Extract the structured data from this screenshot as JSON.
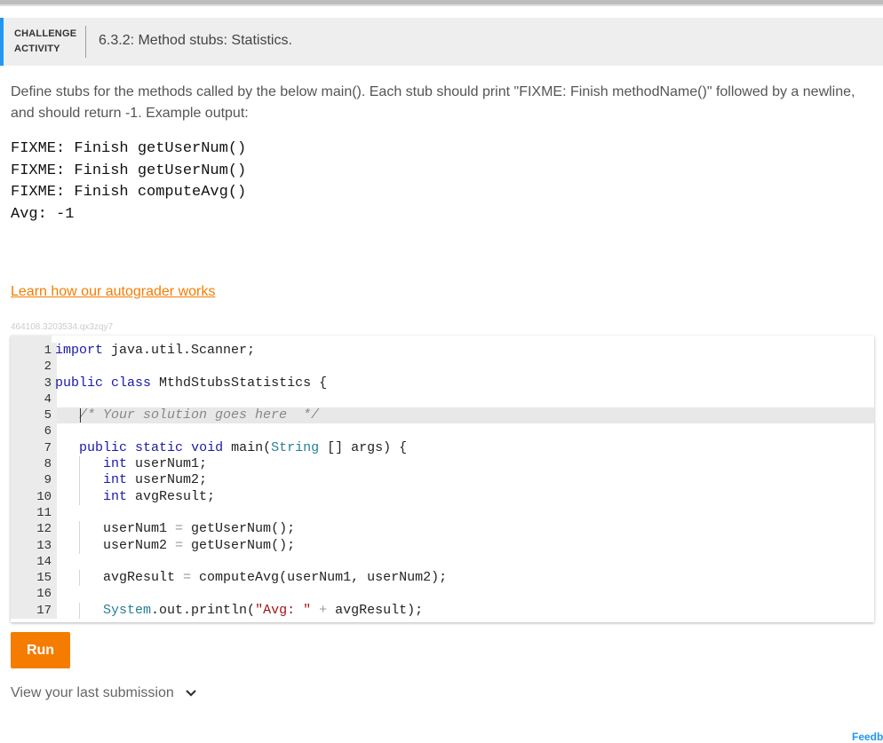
{
  "header": {
    "badge_line1": "CHALLENGE",
    "badge_line2": "ACTIVITY",
    "title": "6.3.2: Method stubs: Statistics."
  },
  "description": "Define stubs for the methods called by the below main(). Each stub should print \"FIXME: Finish methodName()\" followed by a newline, and should return -1. Example output:",
  "example_output": [
    "FIXME: Finish getUserNum()",
    "FIXME: Finish getUserNum()",
    "FIXME: Finish computeAvg()",
    "Avg: -1"
  ],
  "learn_link": "Learn how our autograder works",
  "activity_id": "464108.3203534.qx3zqy7",
  "editor": {
    "line_numbers": [
      "1",
      "2",
      "3",
      "4",
      "5",
      "6",
      "7",
      "8",
      "9",
      "10",
      "11",
      "12",
      "13",
      "14",
      "15",
      "16",
      "17"
    ],
    "active_line": 5
  },
  "run_label": "Run",
  "view_last_label": "View your last submission",
  "feedback_label": "Feedback?",
  "colors": {
    "accent_orange": "#f57c00",
    "header_border": "#2196f3",
    "keyword": "#1a1aa6",
    "string": "#a31515"
  },
  "icons": [
    "chevron-down-icon"
  ]
}
